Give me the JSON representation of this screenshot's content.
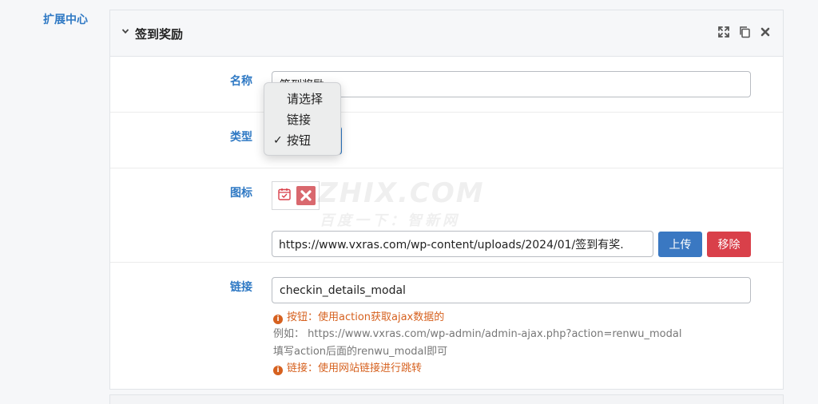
{
  "sidebar": {
    "label": "扩展中心"
  },
  "panel": {
    "title": "签到奖励"
  },
  "fields": {
    "name": {
      "label": "名称",
      "value": "签到奖励"
    },
    "type": {
      "label": "类型",
      "options": [
        "请选择",
        "链接",
        "按钮"
      ],
      "selected": "按钮"
    },
    "icon": {
      "label": "图标",
      "url": "https://www.vxras.com/wp-content/uploads/2024/01/签到有奖.",
      "upload_label": "上传",
      "remove_label": "移除"
    },
    "link": {
      "label": "链接",
      "value": "checkin_details_modal",
      "help": {
        "line1": "按钮：使用action获取ajax数据的",
        "line2": "例如：  https://www.vxras.com/wp-admin/admin-ajax.php?action=renwu_modal",
        "line3": "填写action后面的renwu_modal即可",
        "line4": "链接：使用网站链接进行跳转"
      }
    }
  },
  "watermark": {
    "main": "ZHIX.COM",
    "sub": "百度一下：智新网"
  },
  "colors": {
    "accent": "#2f79c4",
    "upload": "#3a78c2",
    "remove": "#d9404a",
    "help_orange": "#d6611f"
  },
  "icons": [
    "chevron-down-icon",
    "expand-icon",
    "copy-icon",
    "close-icon",
    "calendar-check-icon",
    "delete-image-icon",
    "info-icon",
    "checkmark-icon"
  ]
}
